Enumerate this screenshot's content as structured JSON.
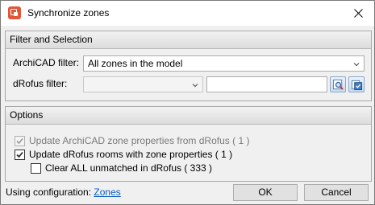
{
  "window": {
    "title": "Synchronize zones",
    "app_icon": "drofus-app-icon",
    "close_icon": "close-icon"
  },
  "filter_section": {
    "header": "Filter and Selection",
    "archicad_label": "ArchiCAD filter:",
    "archicad_value": "All zones in the model",
    "drofus_label": "dRofus filter:",
    "drofus_value": "",
    "drofus_text": "",
    "search_button_icon": "search-icon",
    "select_button_icon": "select-rooms-icon"
  },
  "options_section": {
    "header": "Options",
    "options": [
      {
        "label": "Update ArchiCAD zone properties from dRofus  ( 1 )",
        "checked": true,
        "enabled": false
      },
      {
        "label": "Update dRofus rooms with zone properties  ( 1 )",
        "checked": true,
        "enabled": true
      },
      {
        "label": "Clear ALL unmatched in dRofus ( 333 )",
        "checked": false,
        "enabled": true
      }
    ]
  },
  "footer": {
    "config_prefix": "Using configuration:",
    "config_link": "Zones",
    "ok_label": "OK",
    "cancel_label": "Cancel"
  }
}
